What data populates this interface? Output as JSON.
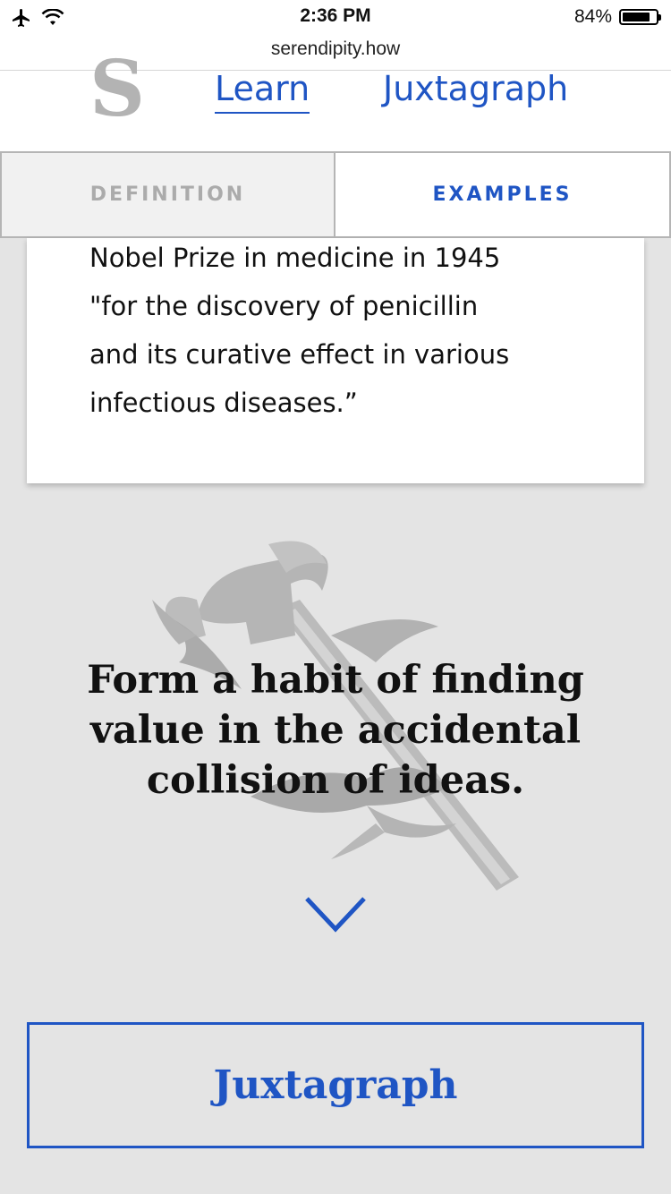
{
  "status_bar": {
    "time": "2:36 PM",
    "battery_percent_label": "84%",
    "battery_level": 0.84,
    "icons": [
      "airplane-icon",
      "wifi-icon",
      "battery-icon"
    ]
  },
  "browser": {
    "url": "serendipity.how"
  },
  "header": {
    "logo": "S",
    "nav": [
      {
        "label": "Learn",
        "active": true
      },
      {
        "label": "Juxtagraph",
        "active": false
      }
    ]
  },
  "tabs": [
    {
      "label": "DEFINITION",
      "active": false
    },
    {
      "label": "EXAMPLES",
      "active": true
    }
  ],
  "example_card": {
    "lines": [
      "Nobel Prize in medicine in 1945",
      "\"for the discovery of penicillin",
      "and its curative effect in various",
      "infectious diseases.”"
    ]
  },
  "hero": {
    "illustration": "hammer-and-swallows-illustration",
    "tagline_lines": [
      "Form a habit of finding",
      "value in the accidental",
      "collision of ideas."
    ]
  },
  "scroll_indicator": "chevron-down-icon",
  "cta": {
    "label": "Juxtagraph"
  },
  "colors": {
    "accent": "#1f55c4",
    "background": "#e4e4e4",
    "logo": "#b3b3b3",
    "inactive_tab_text": "#ababab"
  }
}
